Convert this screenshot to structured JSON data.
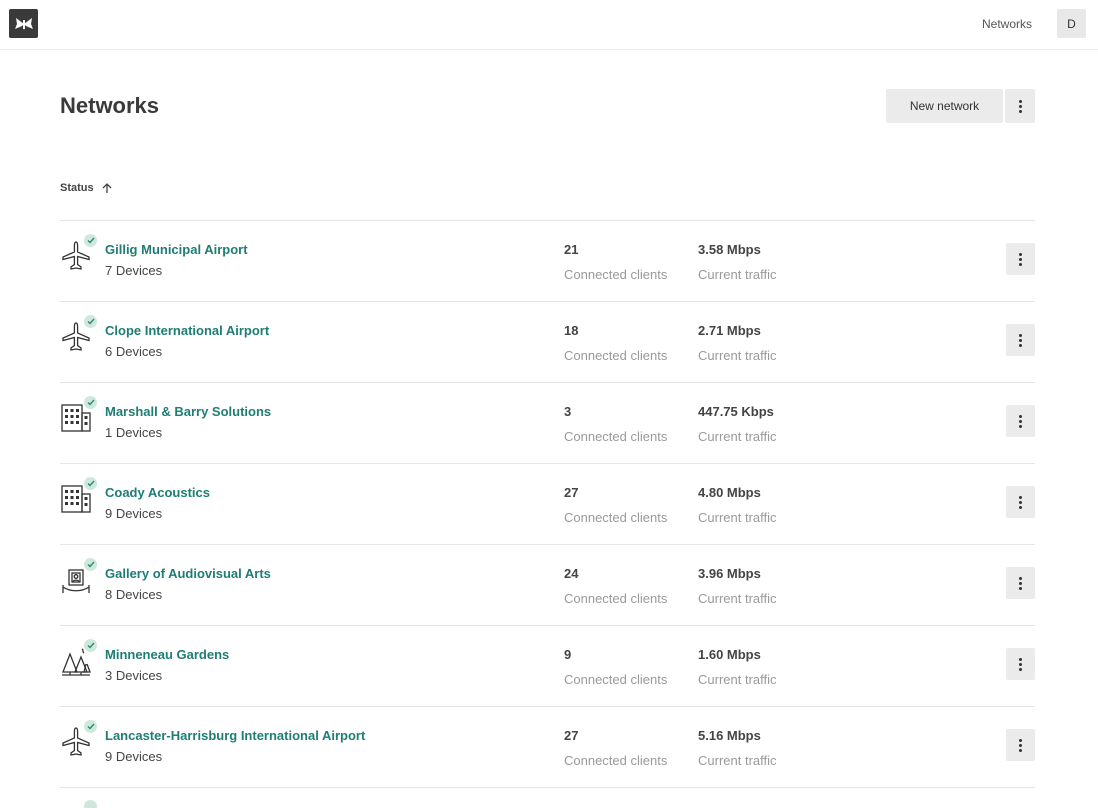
{
  "app": {
    "logo_icon": "butterfly-logo-icon"
  },
  "topbar": {
    "nav_link": "Networks",
    "avatar_initial": "D"
  },
  "page": {
    "title": "Networks"
  },
  "toolbar": {
    "new_network_label": "New network",
    "more_icon": "vertical-dots-icon"
  },
  "sort": {
    "label": "Status",
    "direction_icon": "arrow-up-icon"
  },
  "colors": {
    "accent": "#1e7d74",
    "status_ok": "#cfe8dd",
    "status_check": "#2e8b6a",
    "button_bg": "#ebebeb"
  },
  "networks": [
    {
      "icon": "airplane-icon",
      "name": "Gillig Municipal Airport",
      "devices": "7 Devices",
      "clients": "21",
      "clients_label": "Connected clients",
      "traffic": "3.58 Mbps",
      "traffic_label": "Current traffic"
    },
    {
      "icon": "airplane-icon",
      "name": "Clope International Airport",
      "devices": "6 Devices",
      "clients": "18",
      "clients_label": "Connected clients",
      "traffic": "2.71 Mbps",
      "traffic_label": "Current traffic"
    },
    {
      "icon": "building-icon",
      "name": "Marshall & Barry Solutions",
      "devices": "1 Devices",
      "clients": "3",
      "clients_label": "Connected clients",
      "traffic": "447.75 Kbps",
      "traffic_label": "Current traffic"
    },
    {
      "icon": "building-icon",
      "name": "Coady Acoustics",
      "devices": "9 Devices",
      "clients": "27",
      "clients_label": "Connected clients",
      "traffic": "4.80 Mbps",
      "traffic_label": "Current traffic"
    },
    {
      "icon": "museum-exhibit-icon",
      "name": "Gallery of Audiovisual Arts",
      "devices": "8 Devices",
      "clients": "24",
      "clients_label": "Connected clients",
      "traffic": "3.96 Mbps",
      "traffic_label": "Current traffic"
    },
    {
      "icon": "trees-icon",
      "name": "Minneneau Gardens",
      "devices": "3 Devices",
      "clients": "9",
      "clients_label": "Connected clients",
      "traffic": "1.60 Mbps",
      "traffic_label": "Current traffic"
    },
    {
      "icon": "airplane-icon",
      "name": "Lancaster-Harrisburg International Airport",
      "devices": "9 Devices",
      "clients": "27",
      "clients_label": "Connected clients",
      "traffic": "5.16 Mbps",
      "traffic_label": "Current traffic"
    }
  ]
}
